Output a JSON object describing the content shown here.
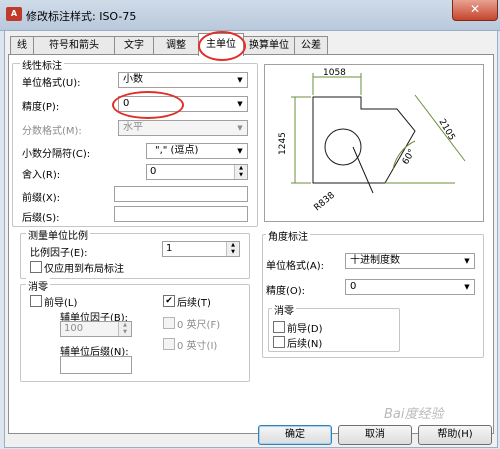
{
  "window": {
    "title": "修改标注样式: ISO-75",
    "close_glyph": "✕",
    "app_icon_text": "A"
  },
  "tabs": [
    {
      "label": "线"
    },
    {
      "label": "符号和箭头"
    },
    {
      "label": "文字"
    },
    {
      "label": "调整"
    },
    {
      "label": "主单位",
      "active": true
    },
    {
      "label": "换算单位"
    },
    {
      "label": "公差"
    }
  ],
  "linear": {
    "group_title": "线性标注",
    "unit_format_label": "单位格式(U):",
    "unit_format_value": "小数",
    "precision_label": "精度(P):",
    "precision_value": "0",
    "fraction_format_label": "分数格式(M):",
    "fraction_format_value": "水平",
    "decimal_separator_label": "小数分隔符(C):",
    "decimal_separator_value": "\",\" (逗点)",
    "round_off_label": "舍入(R):",
    "round_off_value": "0",
    "prefix_label": "前缀(X):",
    "prefix_value": "",
    "suffix_label": "后缀(S):",
    "suffix_value": ""
  },
  "measurement_scale": {
    "group_title": "测量单位比例",
    "scale_factor_label": "比例因子(E):",
    "scale_factor_value": "1",
    "layout_only_label": "仅应用到布局标注"
  },
  "zero_suppression": {
    "group_title": "消零",
    "leading_label": "前导(L)",
    "trailing_label": "后续(T)",
    "trailing_checked": true,
    "sub_unit_factor_label": "辅单位因子(B):",
    "sub_unit_factor_value": "100",
    "sub_unit_suffix_label": "辅单位后缀(N):",
    "sub_unit_suffix_value": "",
    "feet_label": "0 英尺(F)",
    "inches_label": "0 英寸(I)"
  },
  "angular": {
    "group_title": "角度标注",
    "unit_format_label": "单位格式(A):",
    "unit_format_value": "十进制度数",
    "precision_label": "精度(O):",
    "precision_value": "0",
    "zero_group_title": "消零",
    "leading_label": "前导(D)",
    "trailing_label": "后续(N)"
  },
  "preview": {
    "dim_top": "1058",
    "dim_left": "1245",
    "dim_right": "2105",
    "dim_angle": "60°",
    "dim_radius": "R838"
  },
  "buttons": {
    "ok": "确定",
    "cancel": "取消",
    "help": "帮助(H)"
  },
  "watermark": "Bai度经验",
  "colors": {
    "annotation_red": "#e0302a",
    "title_bar": "#c7d5e5",
    "close_red": "#c6442c"
  }
}
